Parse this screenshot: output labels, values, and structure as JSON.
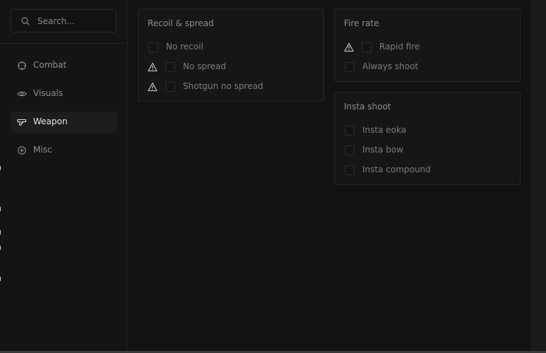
{
  "search": {
    "placeholder": "Search..."
  },
  "sidebar": {
    "items": [
      {
        "label": "Combat",
        "icon": "crosshair-icon"
      },
      {
        "label": "Visuals",
        "icon": "eye-icon"
      },
      {
        "label": "Weapon",
        "icon": "gun-icon",
        "active": true
      },
      {
        "label": "Misc",
        "icon": "plus-circle-icon"
      }
    ]
  },
  "panels": {
    "recoil": {
      "title": "Recoil & spread",
      "options": [
        {
          "label": "No recoil",
          "warning": false,
          "checked": false
        },
        {
          "label": "No spread",
          "warning": true,
          "checked": false
        },
        {
          "label": "Shotgun no spread",
          "warning": true,
          "checked": false
        }
      ]
    },
    "fire_rate": {
      "title": "Fire rate",
      "options": [
        {
          "label": "Rapid fire",
          "warning": true,
          "checked": false
        },
        {
          "label": "Always shoot",
          "warning": false,
          "checked": false
        }
      ]
    },
    "insta_shoot": {
      "title": "Insta shoot",
      "options": [
        {
          "label": "Insta eoka",
          "warning": false,
          "checked": false
        },
        {
          "label": "Insta bow",
          "warning": false,
          "checked": false
        },
        {
          "label": "Insta compound",
          "warning": false,
          "checked": false
        }
      ]
    }
  },
  "colors": {
    "background": "#121212",
    "panel": "#161616",
    "border": "#262626",
    "text_active": "#e6e6e6",
    "text_muted": "#7d7d7d"
  }
}
